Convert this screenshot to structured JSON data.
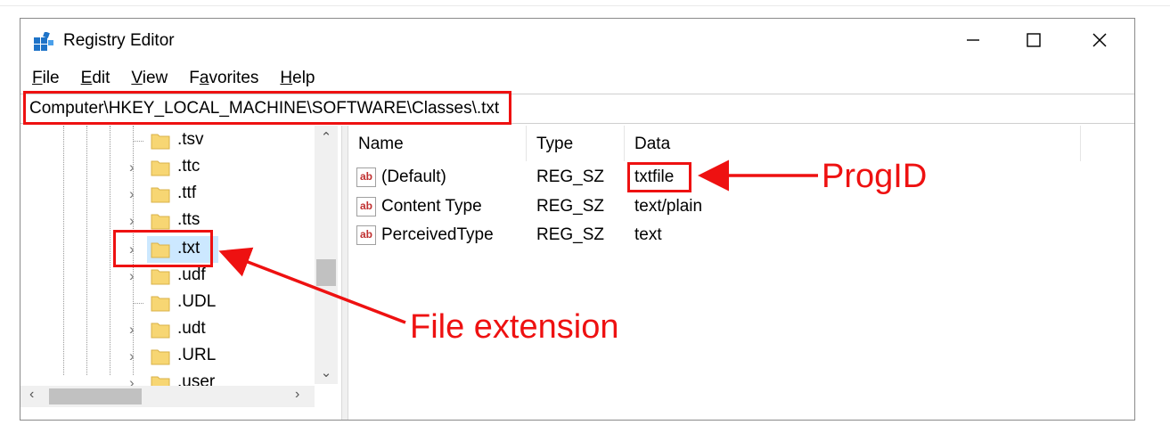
{
  "window": {
    "title": "Registry Editor"
  },
  "menu": [
    {
      "label": "File",
      "mnemonic": "F",
      "rest": "ile"
    },
    {
      "label": "Edit",
      "mnemonic": "E",
      "rest": "dit"
    },
    {
      "label": "View",
      "mnemonic": "V",
      "rest": "iew"
    },
    {
      "label": "Favorites",
      "mnemonic": "a",
      "pre": "F",
      "rest": "vorites"
    },
    {
      "label": "Help",
      "mnemonic": "H",
      "rest": "elp"
    }
  ],
  "address": {
    "path": "Computer\\HKEY_LOCAL_MACHINE\\SOFTWARE\\Classes\\.txt"
  },
  "tree": {
    "items": [
      {
        "label": ".tsv",
        "expandable": false
      },
      {
        "label": ".ttc",
        "expandable": true
      },
      {
        "label": ".ttf",
        "expandable": true
      },
      {
        "label": ".tts",
        "expandable": true
      },
      {
        "label": ".txt",
        "expandable": true,
        "selected": true
      },
      {
        "label": ".udf",
        "expandable": true
      },
      {
        "label": ".UDL",
        "expandable": false
      },
      {
        "label": ".udt",
        "expandable": true
      },
      {
        "label": ".URL",
        "expandable": true
      },
      {
        "label": ".user",
        "expandable": true
      }
    ]
  },
  "list": {
    "columns": [
      "Name",
      "Type",
      "Data"
    ],
    "rows": [
      {
        "name": "(Default)",
        "type": "REG_SZ",
        "data": "txtfile"
      },
      {
        "name": "Content Type",
        "type": "REG_SZ",
        "data": "text/plain"
      },
      {
        "name": "PerceivedType",
        "type": "REG_SZ",
        "data": "text"
      }
    ],
    "icon_text": "ab"
  },
  "annotations": {
    "progid": "ProgID",
    "file_extension": "File extension",
    "color": "#ee1111"
  }
}
